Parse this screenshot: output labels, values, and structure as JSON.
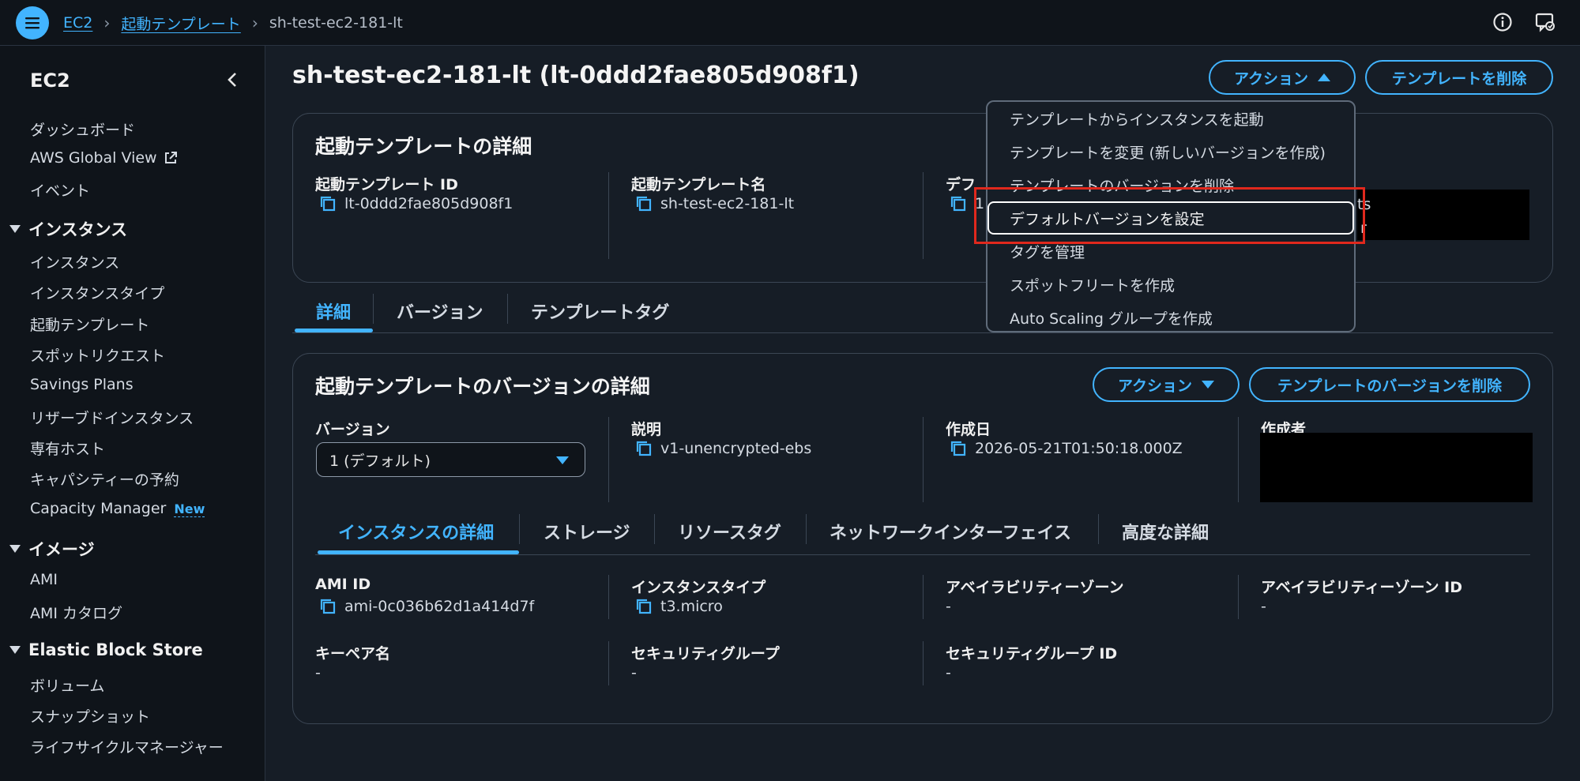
{
  "breadcrumb": {
    "service": "EC2",
    "section": "起動テンプレート",
    "current": "sh-test-ec2-181-lt"
  },
  "sidebar": {
    "title": "EC2",
    "top_items": [
      "ダッシュボード",
      "AWS Global View",
      "イベント"
    ],
    "sections": [
      {
        "label": "インスタンス",
        "items": [
          "インスタンス",
          "インスタンスタイプ",
          "起動テンプレート",
          "スポットリクエスト",
          "Savings Plans",
          "リザーブドインスタンス",
          "専有ホスト",
          "キャパシティーの予約",
          "Capacity Manager"
        ]
      },
      {
        "label": "イメージ",
        "items": [
          "AMI",
          "AMI カタログ"
        ]
      },
      {
        "label": "Elastic Block Store",
        "items": [
          "ボリューム",
          "スナップショット",
          "ライフサイクルマネージャー"
        ]
      }
    ],
    "new_badge": "New"
  },
  "page": {
    "title": "sh-test-ec2-181-lt (lt-0ddd2fae805d908f1)",
    "actions_label": "アクション",
    "delete_template_label": "テンプレートを削除"
  },
  "details_card": {
    "title": "起動テンプレートの詳細",
    "template_id_label": "起動テンプレート ID",
    "template_id": "lt-0ddd2fae805d908f1",
    "template_name_label": "起動テンプレート名",
    "template_name": "sh-test-ec2-181-lt",
    "default_version_label_partial": "デフ",
    "default_version_value_partial": "1",
    "owner_fragment_1": "ts",
    "owner_fragment_2": "r"
  },
  "main_tabs": [
    "詳細",
    "バージョン",
    "テンプレートタグ"
  ],
  "version_card": {
    "title": "起動テンプレートのバージョンの詳細",
    "actions_label": "アクション",
    "delete_version_label": "テンプレートのバージョンを削除",
    "version_label": "バージョン",
    "version_selected": "1 (デフォルト)",
    "description_label": "説明",
    "description": "v1-unencrypted-ebs",
    "created_label": "作成日",
    "created": "2026-05-21T01:50:18.000Z",
    "creator_label": "作成者"
  },
  "sub_tabs": [
    "インスタンスの詳細",
    "ストレージ",
    "リソースタグ",
    "ネットワークインターフェイス",
    "高度な詳細"
  ],
  "instance_details": {
    "ami_id_label": "AMI ID",
    "ami_id": "ami-0c036b62d1a414d7f",
    "instance_type_label": "インスタンスタイプ",
    "instance_type": "t3.micro",
    "az_label": "アベイラビリティーゾーン",
    "az": "-",
    "az_id_label": "アベイラビリティーゾーン ID",
    "az_id": "-",
    "keypair_label": "キーペア名",
    "keypair": "-",
    "sg_label": "セキュリティグループ",
    "sg": "-",
    "sg_id_label": "セキュリティグループ ID",
    "sg_id": "-"
  },
  "actions_menu": {
    "items": [
      "テンプレートからインスタンスを起動",
      "テンプレートを変更 (新しいバージョンを作成)",
      "テンプレートのバージョンを削除",
      "デフォルトバージョンを設定",
      "タグを管理",
      "スポットフリートを作成",
      "Auto Scaling グループを作成"
    ],
    "highlighted_index": 3
  },
  "colors": {
    "accent": "#42b4ff",
    "background": "#161d26",
    "nav": "#0f141a",
    "highlight": "#e0281d"
  }
}
